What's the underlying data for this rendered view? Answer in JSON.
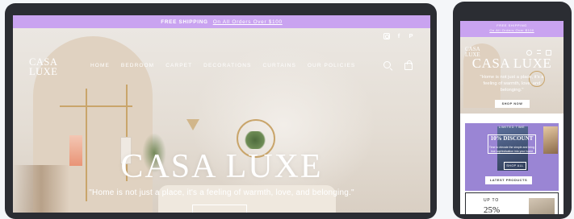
{
  "laptop": {
    "promo": {
      "bold_text": "FREE SHIPPING",
      "link_text": "On All Orders Over $100"
    },
    "social_icons": [
      "instagram-icon",
      "facebook-icon",
      "pinterest-icon"
    ],
    "social_glyphs": {
      "facebook": "f",
      "pinterest": "P"
    },
    "logo": {
      "line1": "CASA",
      "line2": "LUXE"
    },
    "nav": [
      "HOME",
      "BEDROOM",
      "CARPET",
      "DECORATIONS",
      "CURTAINS",
      "OUR POLICIES"
    ],
    "hero": {
      "title": "CASA LUXE",
      "quote": "\"Home is not just a place, it's a feeling of warmth, love, and belonging.\""
    }
  },
  "phone": {
    "promo": {
      "bold_text": "FREE SHIPPING",
      "link_text": "On All Orders Over $100"
    },
    "logo": {
      "line1": "CASA",
      "line2": "LUXE"
    },
    "hero": {
      "title": "CASA LUXE",
      "quote": "\"Home is not just a place, it's a feeling of warmth, love, and belonging.\"",
      "cta": "SHOP NOW"
    },
    "promo_tile": {
      "small": "LIMITED TIME",
      "main": "10% DISCOUNT",
      "desc": "Time to elevate the simple and bring true sophistication into your home",
      "button": "SHOP ALL",
      "button2": "LATEST PRODUCTS"
    },
    "card2": {
      "small": "UP TO",
      "big": "25%"
    }
  },
  "colors": {
    "promo_bar": "#c9a3f0",
    "device_frame": "#2b2d33",
    "promo_tile": "#9a85d4"
  }
}
